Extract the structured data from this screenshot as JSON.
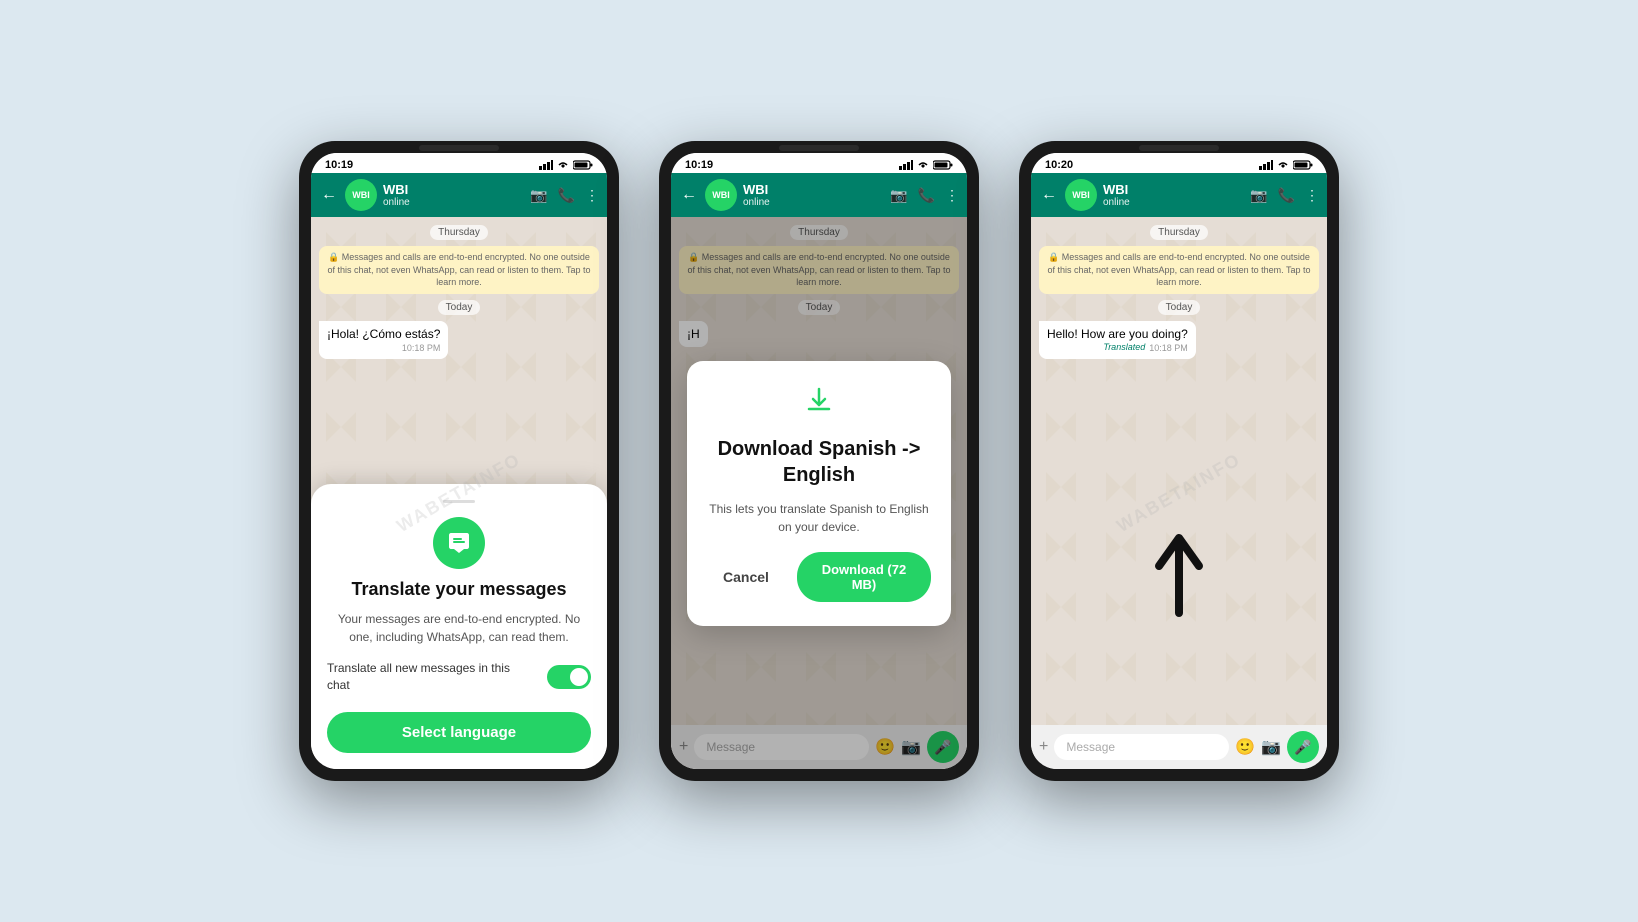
{
  "background_color": "#dce8f0",
  "phones": [
    {
      "id": "phone1",
      "status_bar": {
        "time": "10:19",
        "signal": "▲▲▲",
        "wifi": "WiFi",
        "battery": "🔋"
      },
      "header": {
        "contact_name": "WBI",
        "contact_initials": "WBI",
        "status": "online",
        "back_icon": "←",
        "video_icon": "📷",
        "call_icon": "📞",
        "more_icon": "⋮"
      },
      "chat": {
        "date_thursday": "Thursday",
        "system_msg": "🔒 Messages and calls are end-to-end encrypted. No one outside of this chat, not even WhatsApp, can read or listen to them. Tap to learn more.",
        "date_today": "Today",
        "message_text": "¡Hola! ¿Cómo estás?",
        "message_time": "10:18 PM"
      },
      "bottom_sheet": {
        "title": "Translate your messages",
        "subtitle": "Your messages are end-to-end encrypted. No one, including WhatsApp, can read them.",
        "toggle_label": "Translate all new messages in this chat",
        "toggle_on": true,
        "button_label": "Select language"
      }
    },
    {
      "id": "phone2",
      "status_bar": {
        "time": "10:19"
      },
      "header": {
        "contact_name": "WBI",
        "contact_initials": "WBI",
        "status": "online"
      },
      "chat": {
        "date_thursday": "Thursday",
        "system_msg": "🔒 Messages and calls are end-to-end encrypted. No one outside of this chat, not even WhatsApp, can read or listen to them. Tap to learn more.",
        "date_today": "Today",
        "message_partial": "¡H"
      },
      "dialog": {
        "icon": "⬇",
        "title": "Download Spanish -> English",
        "body": "This lets you translate Spanish to English on your device.",
        "cancel_label": "Cancel",
        "download_label": "Download (72 MB)"
      }
    },
    {
      "id": "phone3",
      "status_bar": {
        "time": "10:20"
      },
      "header": {
        "contact_name": "WBI",
        "contact_initials": "WBI",
        "status": "online"
      },
      "chat": {
        "date_thursday": "Thursday",
        "system_msg": "🔒 Messages and calls are end-to-end encrypted. No one outside of this chat, not even WhatsApp, can read or listen to them. Tap to learn more.",
        "date_today": "Today",
        "message_text": "Hello! How are you doing?",
        "message_translated": "Translated",
        "message_time": "10:18 PM"
      },
      "input_bar": {
        "placeholder": "Message"
      }
    }
  ],
  "watermark": "WABETAINFO"
}
